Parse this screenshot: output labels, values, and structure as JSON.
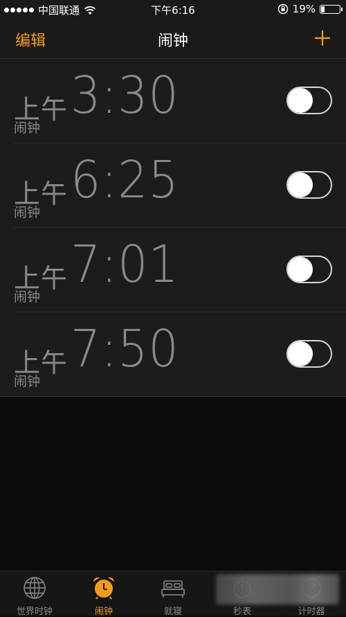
{
  "status_bar": {
    "carrier": "中国联通",
    "time": "下午6:16",
    "battery": "19%",
    "battery_level": 0.19
  },
  "nav": {
    "edit_label": "编辑",
    "title": "闹钟"
  },
  "alarms": [
    {
      "period": "上午",
      "time": "3:30",
      "label": "闹钟",
      "enabled": false
    },
    {
      "period": "上午",
      "time": "6:25",
      "label": "闹钟",
      "enabled": false
    },
    {
      "period": "上午",
      "time": "7:01",
      "label": "闹钟",
      "enabled": false
    },
    {
      "period": "上午",
      "time": "7:50",
      "label": "闹钟",
      "enabled": false
    }
  ],
  "tabs": [
    {
      "label": "世界时钟",
      "icon": "globe-icon",
      "active": false
    },
    {
      "label": "闹钟",
      "icon": "alarm-clock-icon",
      "active": true
    },
    {
      "label": "就寝",
      "icon": "bed-icon",
      "active": false
    },
    {
      "label": "秒表",
      "icon": "stopwatch-icon",
      "active": false
    },
    {
      "label": "计时器",
      "icon": "timer-icon",
      "active": false
    }
  ],
  "colors": {
    "accent": "#f79a1e",
    "background": "#1c1c1c",
    "secondary_text": "#8a8a8a"
  }
}
